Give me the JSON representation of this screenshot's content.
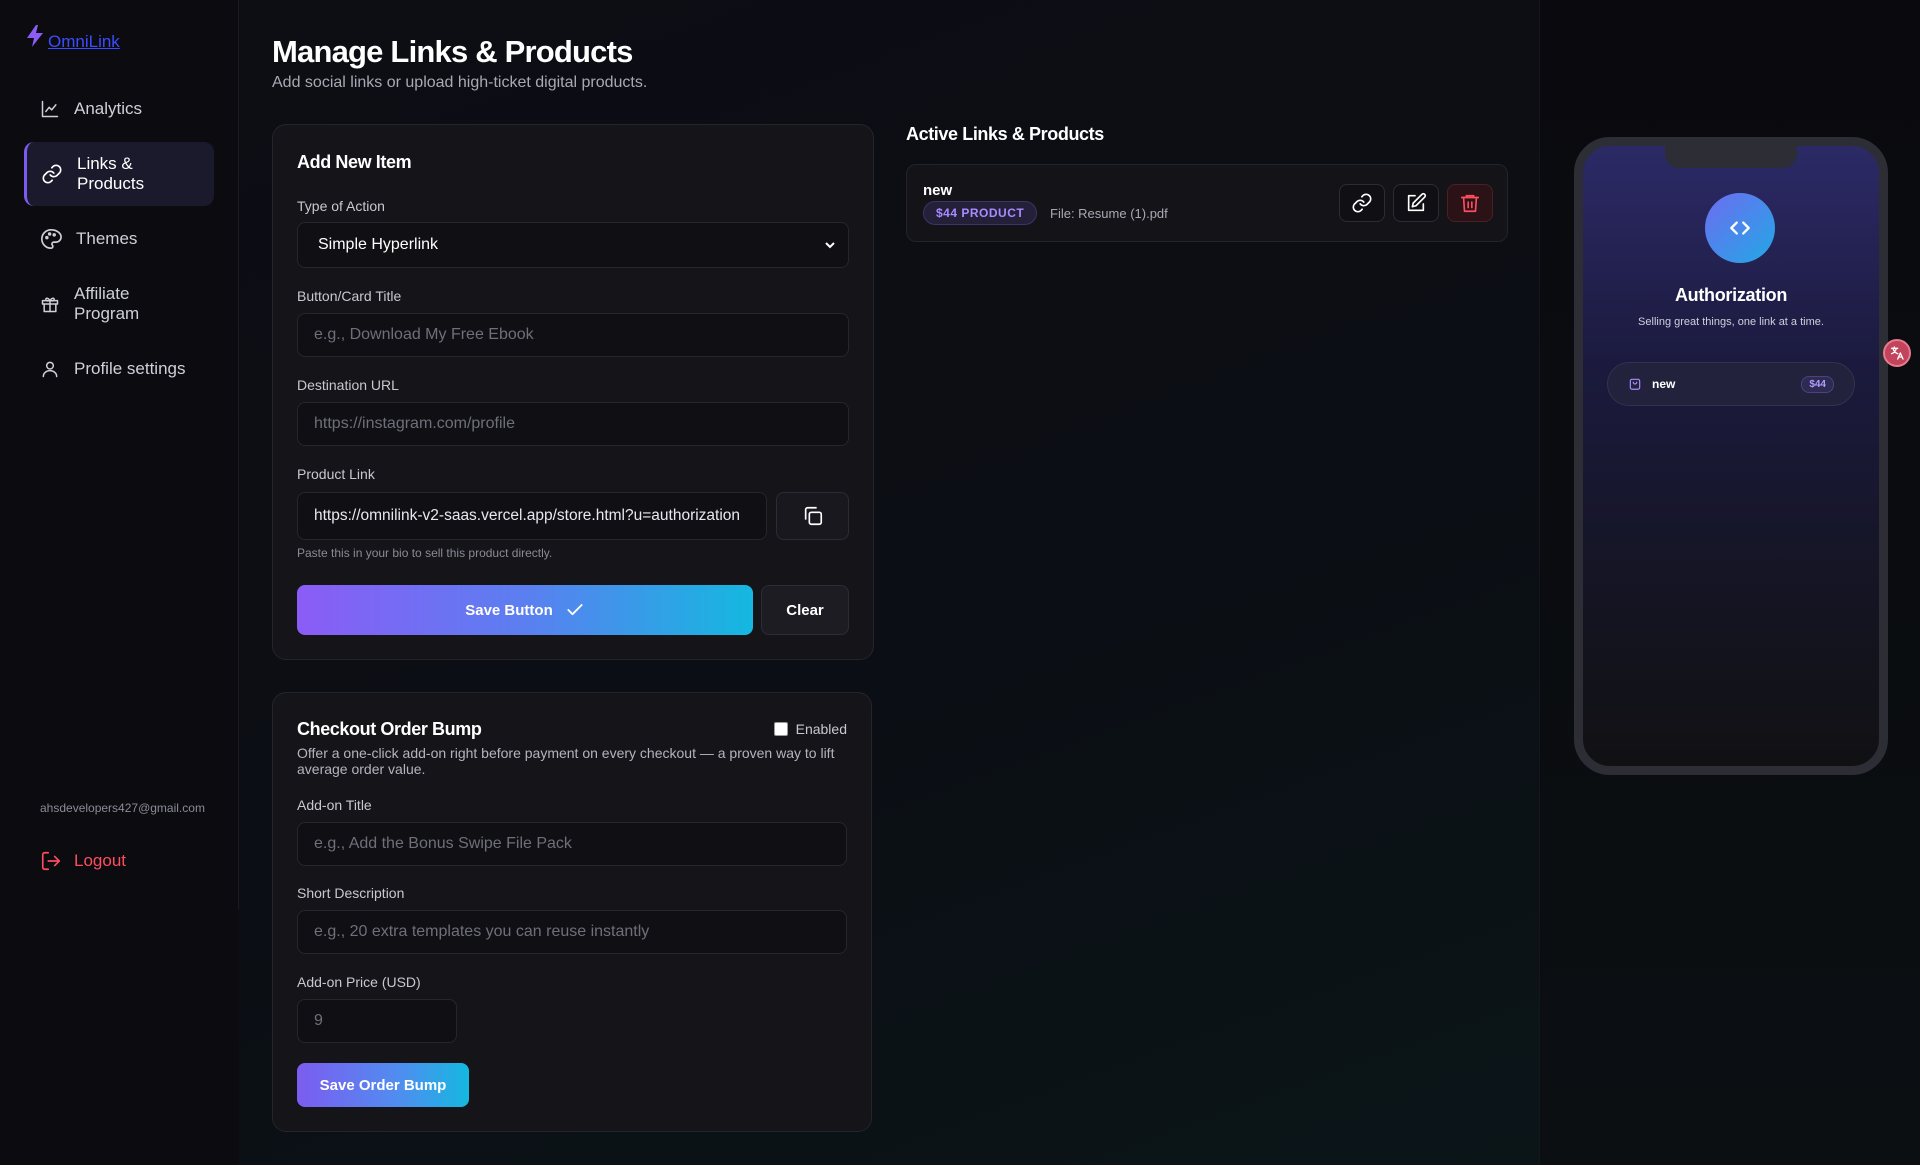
{
  "brand": {
    "name": "OmniLink"
  },
  "sidebar": {
    "items": [
      {
        "label": "Analytics"
      },
      {
        "label_line1": "Links &",
        "label_line2": "Products"
      },
      {
        "label": "Themes"
      },
      {
        "label_line1": "Affiliate",
        "label_line2": "Program"
      },
      {
        "label": "Profile settings"
      }
    ],
    "email": "ahsdevelopers427@gmail.com",
    "logout": "Logout"
  },
  "header": {
    "title": "Manage Links & Products",
    "subtitle": "Add social links or upload high-ticket digital products."
  },
  "add_item": {
    "title": "Add New Item",
    "type_label": "Type of Action",
    "type_value": "Simple Hyperlink",
    "title_label": "Button/Card Title",
    "title_placeholder": "e.g., Download My Free Ebook",
    "url_label": "Destination URL",
    "url_placeholder": "https://instagram.com/profile",
    "product_link_label": "Product Link",
    "product_link_value": "https://omnilink-v2-saas.vercel.app/store.html?u=authorization",
    "hint": "Paste this in your bio to sell this product directly.",
    "save_label": "Save Button",
    "clear_label": "Clear"
  },
  "order_bump": {
    "title": "Checkout Order Bump",
    "enabled_label": "Enabled",
    "enabled": false,
    "description": "Offer a one-click add-on right before payment on every checkout — a proven way to lift average order value.",
    "addon_title_label": "Add-on Title",
    "addon_title_placeholder": "e.g., Add the Bonus Swipe File Pack",
    "short_desc_label": "Short Description",
    "short_desc_placeholder": "e.g., 20 extra templates you can reuse instantly",
    "price_label": "Add-on Price (USD)",
    "price_placeholder": "9",
    "save_label": "Save Order Bump"
  },
  "active": {
    "title": "Active Links & Products",
    "items": [
      {
        "name": "new",
        "badge": "$44 PRODUCT",
        "file": "File: Resume (1).pdf"
      }
    ]
  },
  "preview": {
    "name": "Authorization",
    "bio": "Selling great things, one link at a time.",
    "links": [
      {
        "name": "new",
        "price": "$44"
      }
    ]
  },
  "colors": {
    "accent": "#7c5cf0",
    "gradient_start": "#8b5cf6",
    "gradient_end": "#14b8e0",
    "danger": "#ff4d5e"
  }
}
